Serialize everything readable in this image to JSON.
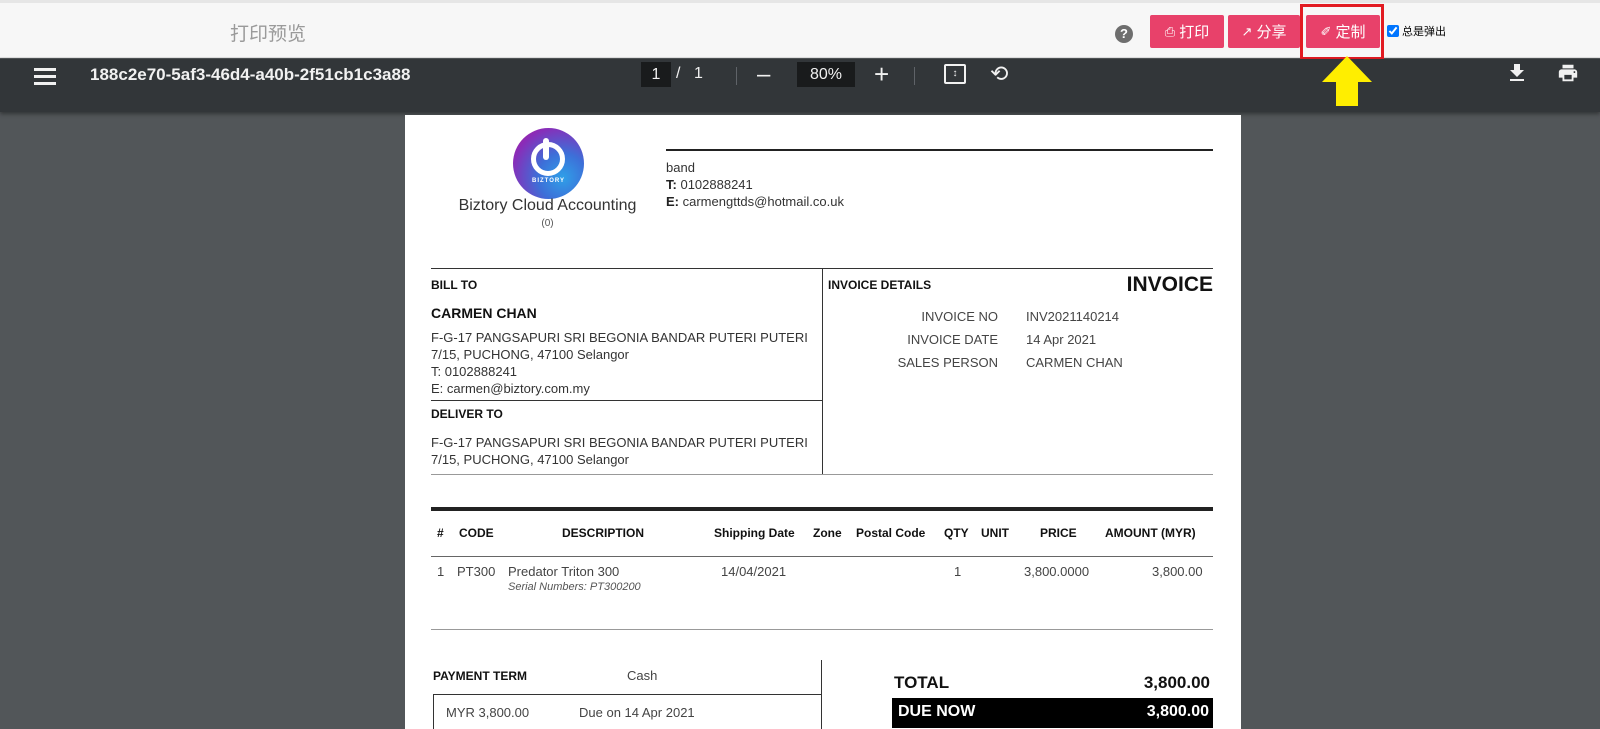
{
  "header": {
    "title": "打印预览",
    "print_label": "打印",
    "share_label": "分享",
    "custom_label": "定制",
    "always_popup_label": "总是弹出",
    "help_glyph": "?"
  },
  "pdf_toolbar": {
    "filename": "188c2e70-5af3-46d4-a40b-2f51cb1c3a88",
    "current_page": "1",
    "separator": "/",
    "total_pages": "1",
    "zoom": "80%"
  },
  "document": {
    "logo_text": "BIZTORY",
    "company_name": "Biztory Cloud Accounting",
    "company_sub": "(0)",
    "org": {
      "name": "band",
      "phone_label": "T:",
      "phone": "0102888241",
      "email_label": "E:",
      "email": "carmengttds@hotmail.co.uk"
    },
    "bill_to": {
      "label": "BILL TO",
      "name": "CARMEN CHAN",
      "address_line1": "F-G-17 PANGSAPURI SRI BEGONIA BANDAR PUTERI PUTERI",
      "address_line2": "7/15, PUCHONG, 47100 Selangor",
      "phone_line": "T: 0102888241",
      "email_line": "E: carmen@biztory.com.my"
    },
    "deliver_to": {
      "label": "DELIVER TO",
      "address_line1": "F-G-17 PANGSAPURI SRI BEGONIA BANDAR PUTERI PUTERI",
      "address_line2": "7/15, PUCHONG, 47100 Selangor"
    },
    "invoice_details": {
      "label": "INVOICE DETAILS",
      "title": "INVOICE",
      "rows": [
        {
          "key": "INVOICE NO",
          "value": "INV2021140214"
        },
        {
          "key": "INVOICE DATE",
          "value": "14 Apr 2021"
        },
        {
          "key": "SALES PERSON",
          "value": "CARMEN CHAN"
        }
      ]
    },
    "table": {
      "headers": [
        "#",
        "CODE",
        "DESCRIPTION",
        "Shipping Date",
        "Zone",
        "Postal Code",
        "QTY",
        "UNIT",
        "PRICE",
        "AMOUNT (MYR)"
      ],
      "rows": [
        {
          "num": "1",
          "code": "PT300",
          "description": "Predator Triton 300",
          "serial": "Serial Numbers: PT300200",
          "shipping_date": "14/04/2021",
          "zone": "",
          "postal_code": "",
          "qty": "1",
          "unit": "",
          "price": "3,800.0000",
          "amount": "3,800.00"
        }
      ]
    },
    "payment": {
      "term_label": "PAYMENT TERM",
      "term_value": "Cash",
      "amount": "MYR 3,800.00",
      "due": "Due on 14 Apr 2021"
    },
    "totals": {
      "total_label": "TOTAL",
      "total_value": "3,800.00",
      "due_now_label": "DUE NOW",
      "due_now_value": "3,800.00"
    }
  },
  "colors": {
    "brand_pink": "#e8416a",
    "highlight_red": "#e21b22",
    "arrow_yellow": "#ffee00",
    "pdf_toolbar": "#323639",
    "pdf_background": "#525659"
  }
}
